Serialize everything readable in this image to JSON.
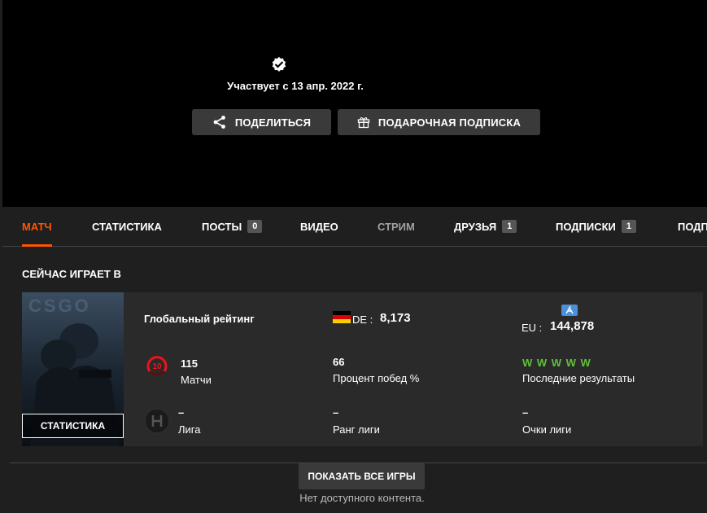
{
  "hero": {
    "member_since": "Участвует с 13 апр. 2022 г.",
    "share_label": "ПОДЕЛИТЬСЯ",
    "gift_label": "ПОДАРОЧНАЯ ПОДПИСКА",
    "verified_icon": "verified-badge-icon"
  },
  "tabs": [
    {
      "label": "МАТЧ",
      "active": true
    },
    {
      "label": "СТАТИСТИКА"
    },
    {
      "label": "ПОСТЫ",
      "count": "0"
    },
    {
      "label": "ВИДЕО"
    },
    {
      "label": "СТРИМ",
      "muted": true
    },
    {
      "label": "ДРУЗЬЯ",
      "count": "1"
    },
    {
      "label": "ПОДПИСКИ",
      "count": "1"
    },
    {
      "label": "ПОДП"
    }
  ],
  "now_playing": {
    "title": "СЕЙЧАС ИГРАЕТ В",
    "cover_overlay": "СТАТИСТИКА",
    "global_rating_label": "Глобальный рейтинг",
    "country_code": "DE :",
    "country_rank": "8,173",
    "region_code": "EU :",
    "region_rank": "144,878",
    "matches_value": "115",
    "matches_label": "Матчи",
    "winrate_value": "66",
    "winrate_label": "Процент побед %",
    "recent_results": "W W W W W",
    "recent_label": "Последние результаты",
    "league_value": "–",
    "league_label": "Лига",
    "league_rank_value": "–",
    "league_rank_label": "Ранг лиги",
    "league_points_value": "–",
    "league_points_label": "Очки лиги",
    "skill_level": "10",
    "colors": {
      "accent": "#ff5500",
      "win": "#5fc23a",
      "skill": "#e8161c"
    }
  },
  "footer": {
    "show_all_label": "ПОКАЗАТЬ ВСЕ ИГРЫ",
    "no_content": "Нет доступного контента."
  }
}
